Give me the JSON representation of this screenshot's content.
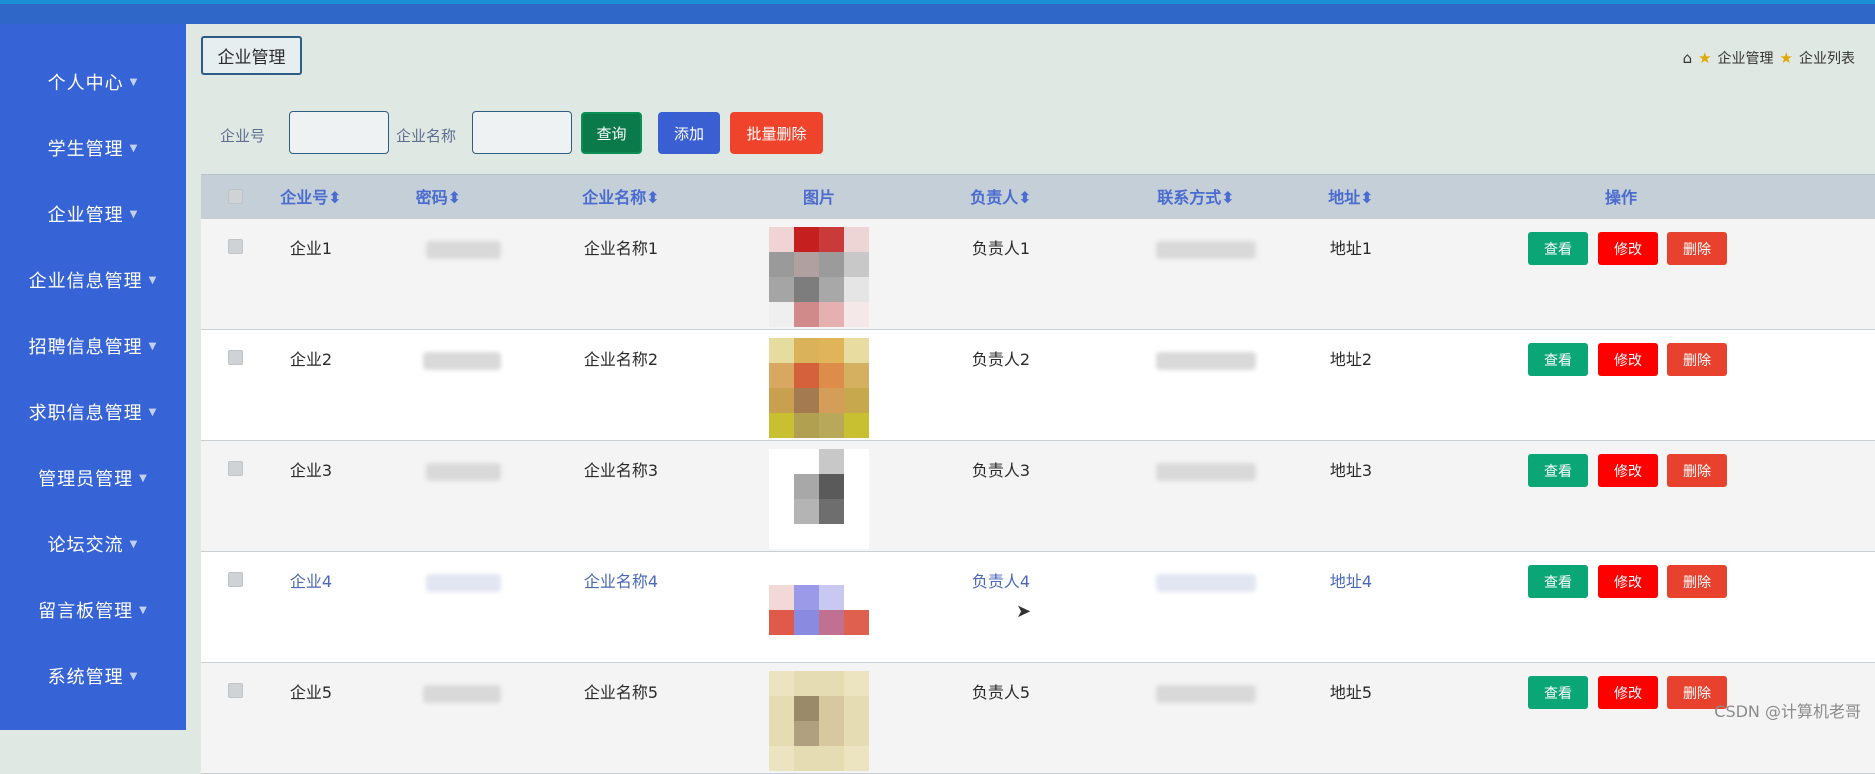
{
  "sidebar": {
    "items": [
      {
        "label": "个人中心"
      },
      {
        "label": "学生管理"
      },
      {
        "label": "企业管理"
      },
      {
        "label": "企业信息管理"
      },
      {
        "label": "招聘信息管理"
      },
      {
        "label": "求职信息管理"
      },
      {
        "label": "管理员管理"
      },
      {
        "label": "论坛交流"
      },
      {
        "label": "留言板管理"
      },
      {
        "label": "系统管理"
      }
    ]
  },
  "header": {
    "page_button": "企业管理",
    "breadcrumb": [
      "企业管理",
      "企业列表"
    ]
  },
  "search": {
    "label_id": "企业号",
    "label_name": "企业名称",
    "id_value": "",
    "name_value": "",
    "query_button": "查询",
    "add_button": "添加",
    "batch_delete_button": "批量删除"
  },
  "table": {
    "columns": [
      "企业号",
      "密码",
      "企业名称",
      "图片",
      "负责人",
      "联系方式",
      "地址",
      "操作"
    ],
    "rows": [
      {
        "id": "企业1",
        "name": "企业名称1",
        "manager": "负责人1",
        "address": "地址1"
      },
      {
        "id": "企业2",
        "name": "企业名称2",
        "manager": "负责人2",
        "address": "地址2"
      },
      {
        "id": "企业3",
        "name": "企业名称3",
        "manager": "负责人3",
        "address": "地址3"
      },
      {
        "id": "企业4",
        "name": "企业名称4",
        "manager": "负责人4",
        "address": "地址4"
      },
      {
        "id": "企业5",
        "name": "企业名称5",
        "manager": "负责人5",
        "address": "地址5"
      }
    ],
    "actions": {
      "view": "查看",
      "edit": "修改",
      "delete": "删除"
    }
  },
  "watermark": "CSDN @计算机老哥",
  "colors": {
    "sidebar": "#3663d6",
    "query": "#0a7a4b",
    "add": "#3a5fd2",
    "batch_delete": "#f0432c",
    "view": "#0ba675",
    "edit": "#ff0000",
    "delete": "#e8422f"
  }
}
